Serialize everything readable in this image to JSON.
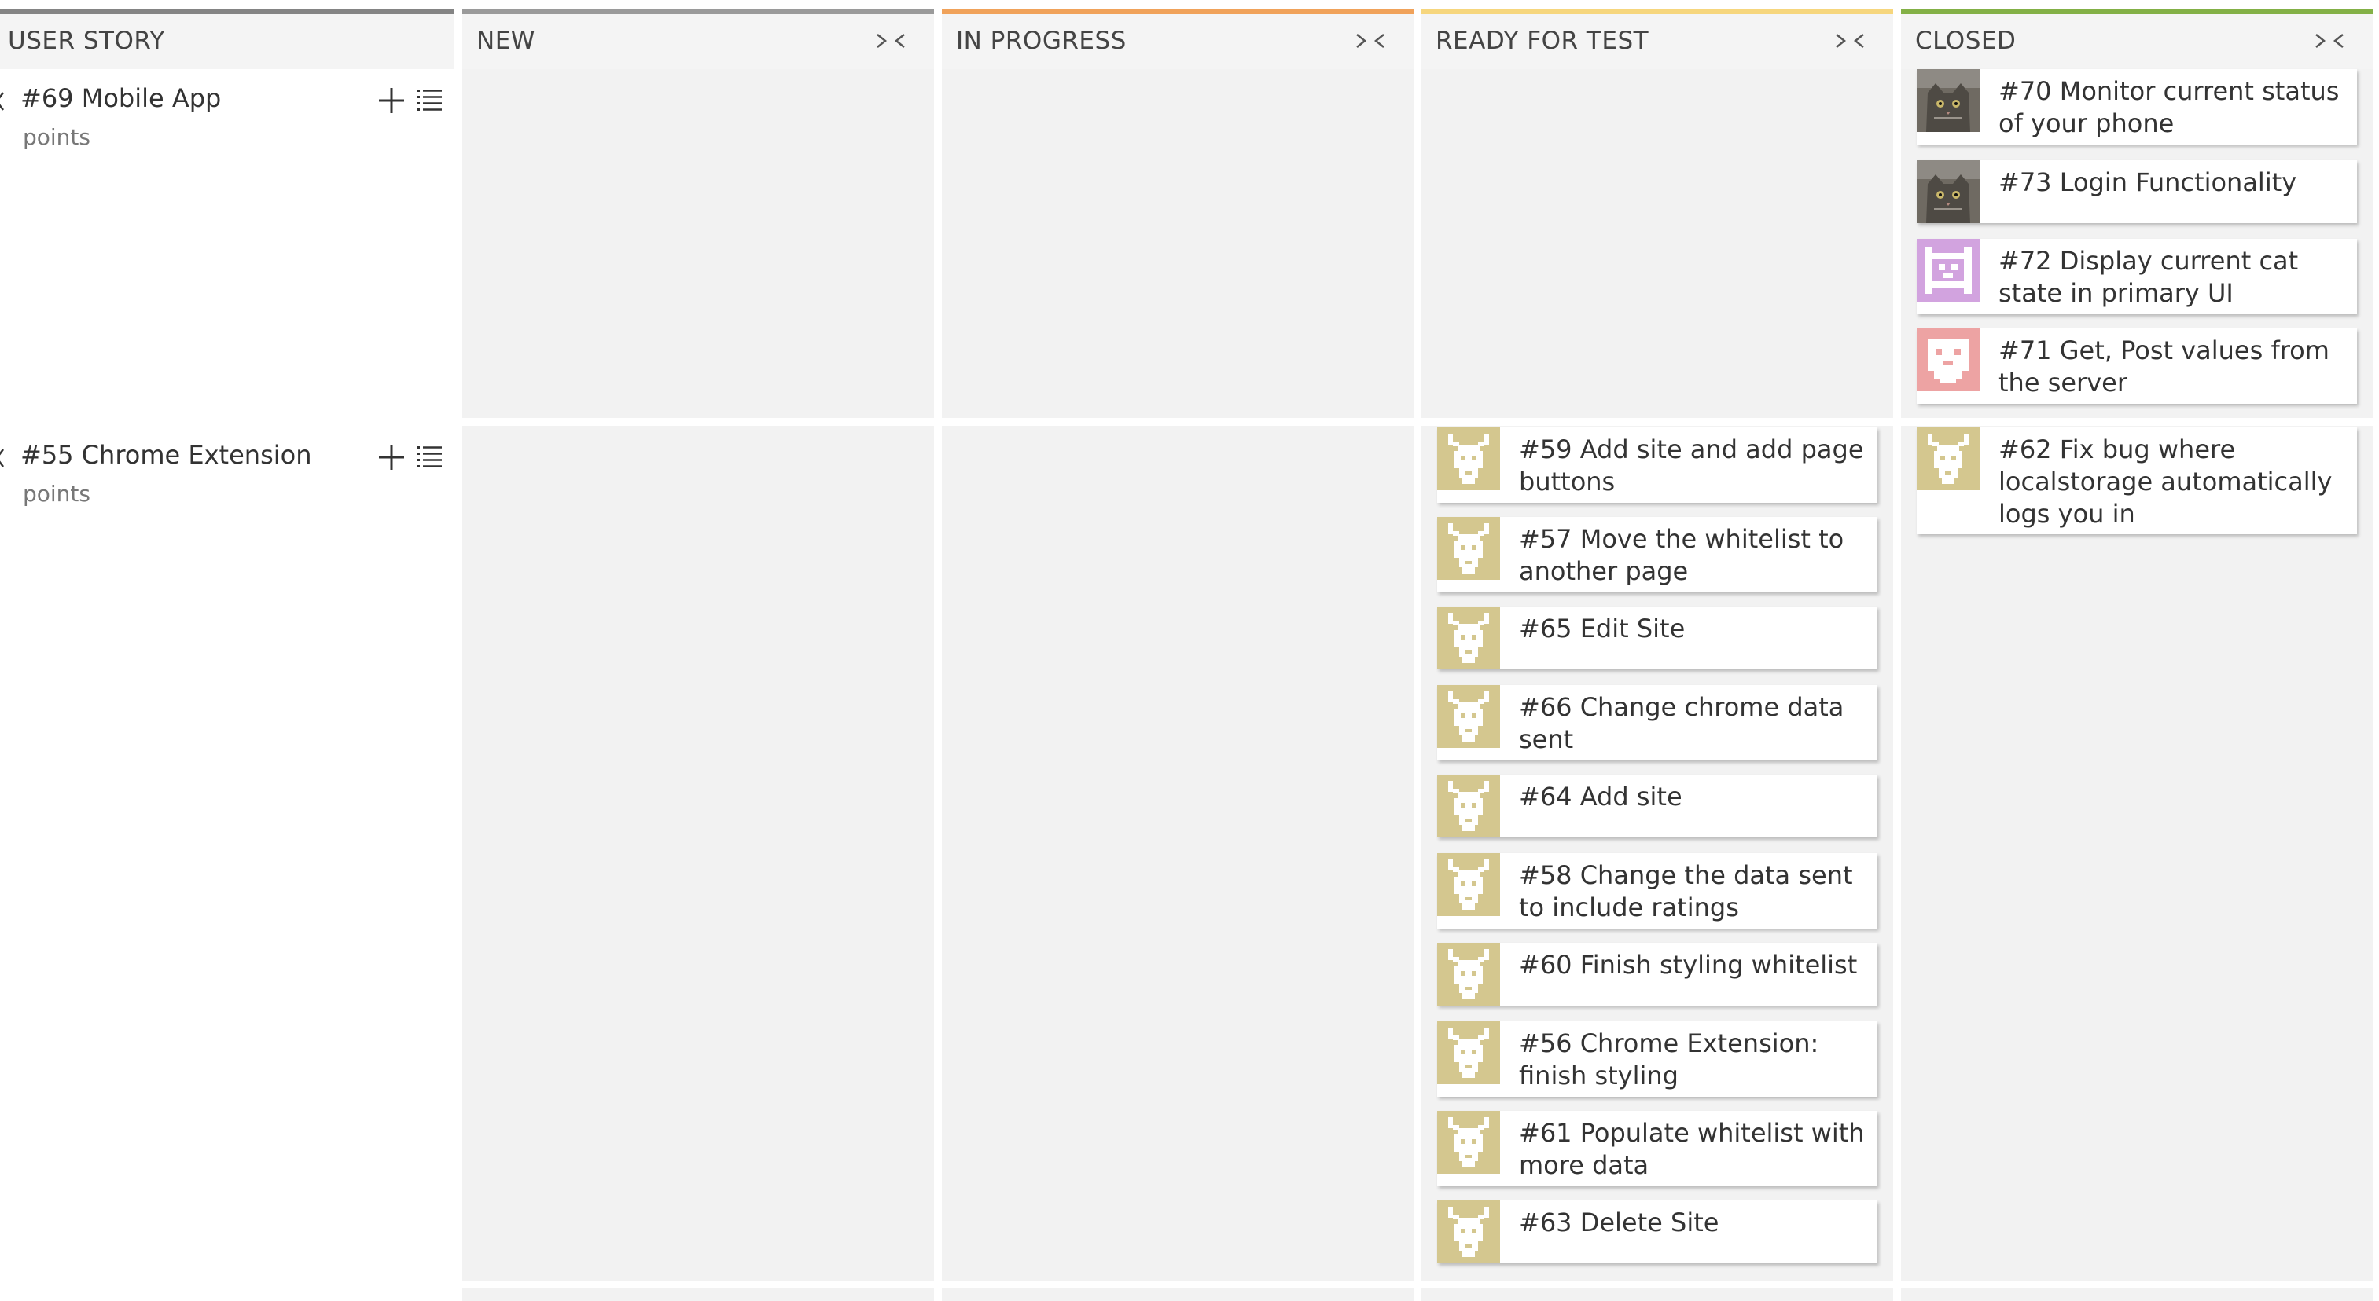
{
  "columns": [
    {
      "id": "userstory",
      "label": "USER STORY",
      "color": "#848484",
      "foldable": false
    },
    {
      "id": "new",
      "label": "NEW",
      "color": "#9a9a9a",
      "foldable": true
    },
    {
      "id": "inprogress",
      "label": "IN PROGRESS",
      "color": "#f0a25a",
      "foldable": true
    },
    {
      "id": "readyfortest",
      "label": "READY FOR TEST",
      "color": "#f6d67d",
      "foldable": true
    },
    {
      "id": "closed",
      "label": "CLOSED",
      "color": "#83b046",
      "foldable": true
    }
  ],
  "stories": [
    {
      "title": "#69 Mobile App",
      "points": "points"
    },
    {
      "title": "#55 Chrome Extension",
      "points": "points"
    }
  ],
  "cards": {
    "closed_row1": [
      {
        "text": "#70 Monitor current status of your phone",
        "avatar": "cat-photo"
      },
      {
        "text": "#73 Login Functionality",
        "avatar": "cat-photo"
      },
      {
        "text": "#72 Display current cat state in primary UI",
        "avatar": "purple-pixel-avatar"
      },
      {
        "text": "#71 Get, Post values from the server",
        "avatar": "pink-pixel-avatar"
      }
    ],
    "readyfortest_row2": [
      {
        "text": "#59 Add site and add page buttons",
        "avatar": "beige-pixel-avatar"
      },
      {
        "text": "#57 Move the whitelist to another page",
        "avatar": "beige-pixel-avatar"
      },
      {
        "text": "#65 Edit Site",
        "avatar": "beige-pixel-avatar"
      },
      {
        "text": "#66 Change chrome data sent",
        "avatar": "beige-pixel-avatar"
      },
      {
        "text": "#64 Add site",
        "avatar": "beige-pixel-avatar"
      },
      {
        "text": "#58 Change the data sent to include ratings",
        "avatar": "beige-pixel-avatar"
      },
      {
        "text": "#60 Finish styling whitelist",
        "avatar": "beige-pixel-avatar"
      },
      {
        "text": "#56 Chrome Extension: finish styling",
        "avatar": "beige-pixel-avatar"
      },
      {
        "text": "#61 Populate whitelist with more data",
        "avatar": "beige-pixel-avatar"
      },
      {
        "text": "#63 Delete Site",
        "avatar": "beige-pixel-avatar"
      }
    ],
    "closed_row2": [
      {
        "text": "#62 Fix bug where localstorage automatically logs you in",
        "avatar": "beige-pixel-avatar"
      }
    ]
  },
  "colors": {
    "beige_avatar": "#d4c78f",
    "purple_avatar": "#d2a3df",
    "pink_avatar": "#eda3a3"
  }
}
